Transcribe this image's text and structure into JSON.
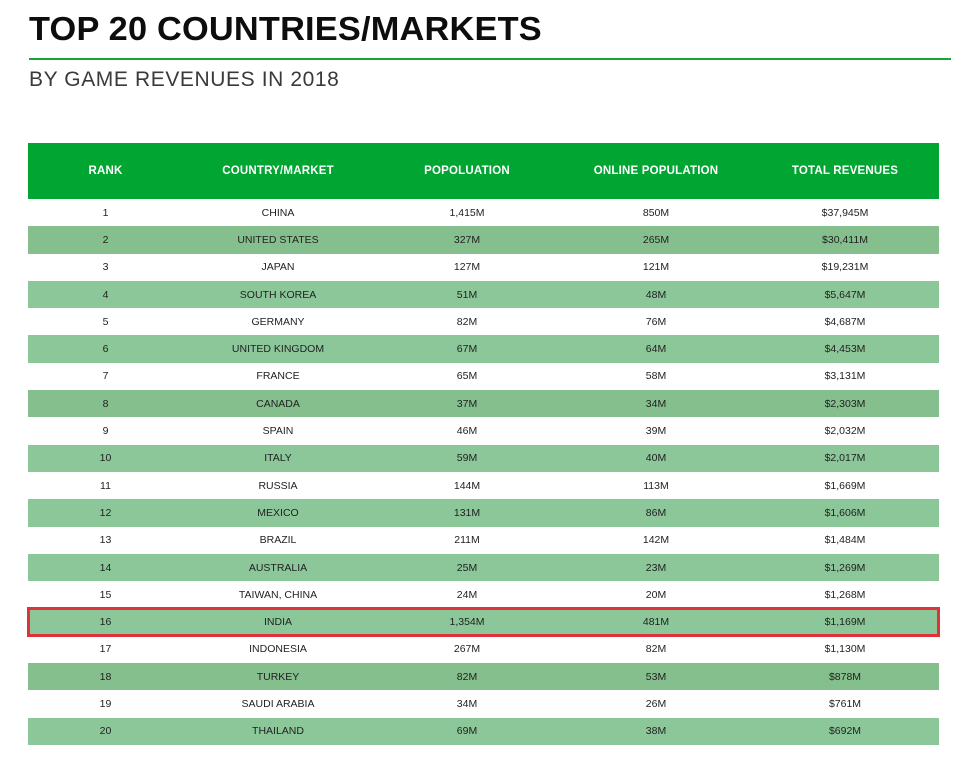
{
  "header": {
    "title": "TOP 20 COUNTRIES/MARKETS",
    "subtitle": "BY GAME REVENUES IN 2018"
  },
  "colors": {
    "header_green": "#00a532",
    "rule_green": "#1aa33a",
    "row_green": "#8cc79a",
    "highlight_red": "#e0323a"
  },
  "table": {
    "columns": [
      "RANK",
      "COUNTRY/MARKET",
      "POPOLUATION",
      "ONLINE POPULATION",
      "TOTAL REVENUES"
    ],
    "highlighted_rank": "16",
    "rows": [
      {
        "rank": "1",
        "country": "CHINA",
        "population": "1,415M",
        "online": "850M",
        "revenue": "$37,945M"
      },
      {
        "rank": "2",
        "country": "UNITED STATES",
        "population": "327M",
        "online": "265M",
        "revenue": "$30,411M"
      },
      {
        "rank": "3",
        "country": "JAPAN",
        "population": "127M",
        "online": "121M",
        "revenue": "$19,231M"
      },
      {
        "rank": "4",
        "country": "SOUTH KOREA",
        "population": "51M",
        "online": "48M",
        "revenue": "$5,647M"
      },
      {
        "rank": "5",
        "country": "GERMANY",
        "population": "82M",
        "online": "76M",
        "revenue": "$4,687M"
      },
      {
        "rank": "6",
        "country": "UNITED KINGDOM",
        "population": "67M",
        "online": "64M",
        "revenue": "$4,453M"
      },
      {
        "rank": "7",
        "country": "FRANCE",
        "population": "65M",
        "online": "58M",
        "revenue": "$3,131M"
      },
      {
        "rank": "8",
        "country": "CANADA",
        "population": "37M",
        "online": "34M",
        "revenue": "$2,303M"
      },
      {
        "rank": "9",
        "country": "SPAIN",
        "population": "46M",
        "online": "39M",
        "revenue": "$2,032M"
      },
      {
        "rank": "10",
        "country": "ITALY",
        "population": "59M",
        "online": "40M",
        "revenue": "$2,017M"
      },
      {
        "rank": "11",
        "country": "RUSSIA",
        "population": "144M",
        "online": "113M",
        "revenue": "$1,669M"
      },
      {
        "rank": "12",
        "country": "MEXICO",
        "population": "131M",
        "online": "86M",
        "revenue": "$1,606M"
      },
      {
        "rank": "13",
        "country": "BRAZIL",
        "population": "211M",
        "online": "142M",
        "revenue": "$1,484M"
      },
      {
        "rank": "14",
        "country": "AUSTRALIA",
        "population": "25M",
        "online": "23M",
        "revenue": "$1,269M"
      },
      {
        "rank": "15",
        "country": "TAIWAN, CHINA",
        "population": "24M",
        "online": "20M",
        "revenue": "$1,268M"
      },
      {
        "rank": "16",
        "country": "INDIA",
        "population": "1,354M",
        "online": "481M",
        "revenue": "$1,169M"
      },
      {
        "rank": "17",
        "country": "INDONESIA",
        "population": "267M",
        "online": "82M",
        "revenue": "$1,130M"
      },
      {
        "rank": "18",
        "country": "TURKEY",
        "population": "82M",
        "online": "53M",
        "revenue": "$878M"
      },
      {
        "rank": "19",
        "country": "SAUDI ARABIA",
        "population": "34M",
        "online": "26M",
        "revenue": "$761M"
      },
      {
        "rank": "20",
        "country": "THAILAND",
        "population": "69M",
        "online": "38M",
        "revenue": "$692M"
      }
    ]
  }
}
